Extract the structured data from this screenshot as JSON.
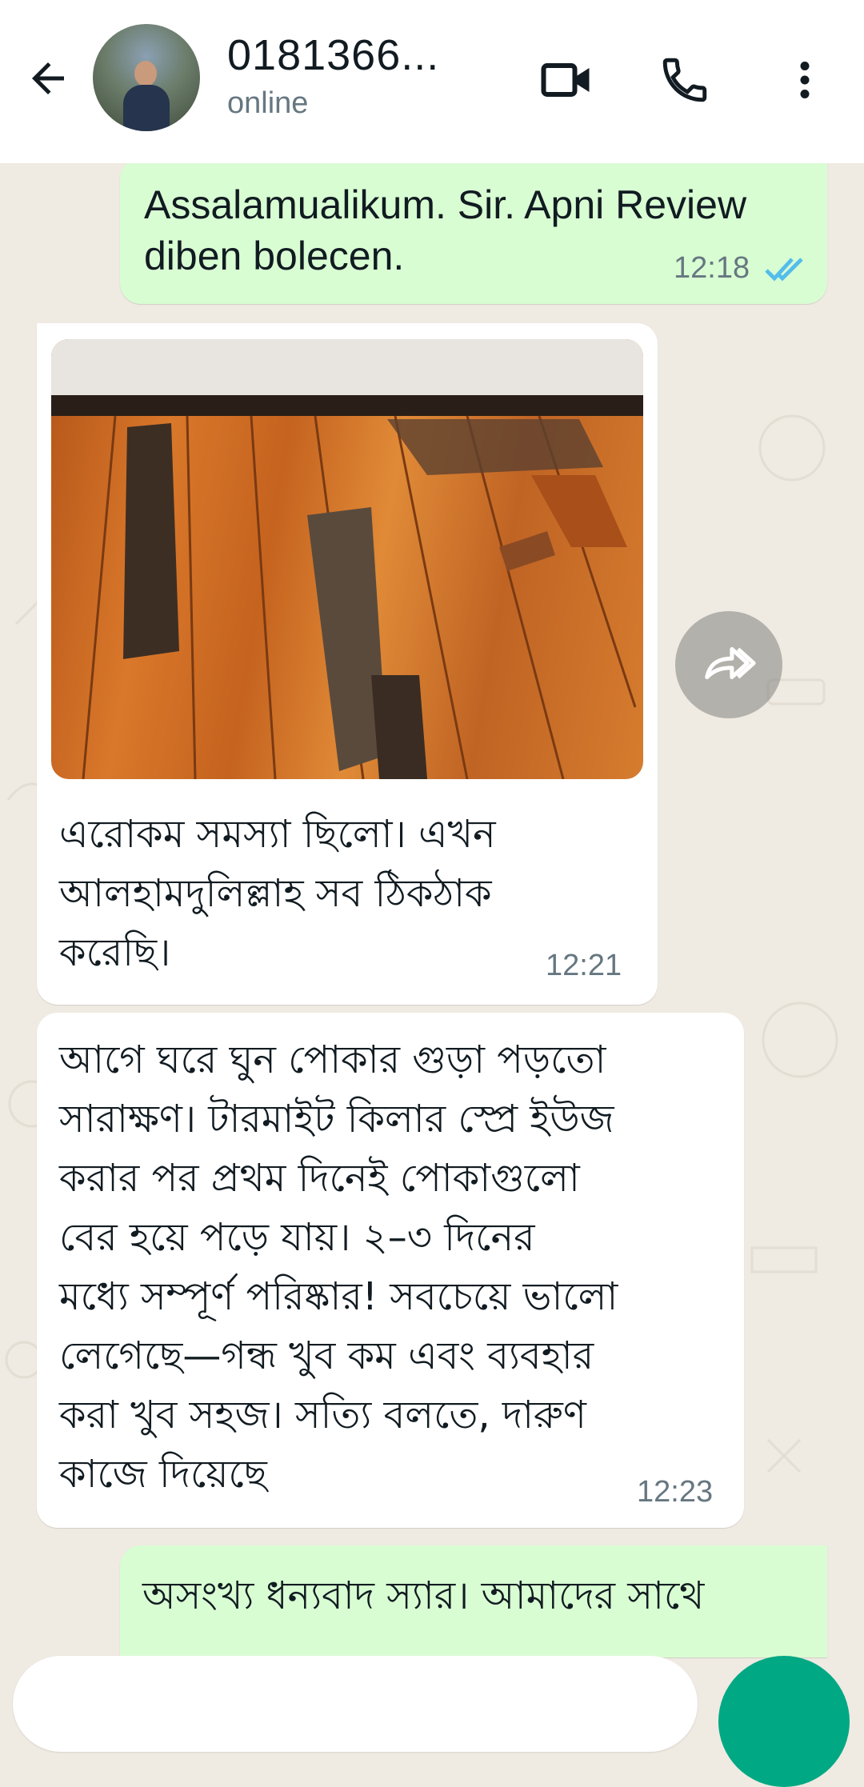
{
  "header": {
    "contact_name": "0181366...",
    "status": "online"
  },
  "messages": [
    {
      "direction": "outgoing",
      "text_line1": "Assalamualikum. Sir. Apni Review",
      "text_line2": "diben bolecen.",
      "time": "12:18",
      "read": true
    },
    {
      "direction": "incoming",
      "type": "image",
      "caption_lines": [
        "এরোকম সমস্যা ছিলো। এখন",
        "আলহামদুলিল্লাহ সব ঠিকঠাক",
        "করেছি।"
      ],
      "time": "12:21"
    },
    {
      "direction": "incoming",
      "lines": [
        "আগে ঘরে ঘুন পোকার গুড়া পড়তো",
        "সারাক্ষণ। টারমাইট কিলার স্প্রে ইউজ",
        "করার পর প্রথম দিনেই পোকাগুলো",
        "বের হয়ে পড়ে যায়। ২–৩ দিনের",
        "মধ্যে সম্পূর্ণ পরিষ্কার! সবচেয়ে ভালো",
        "লেগেছে—গন্ধ খুব কম এবং ব্যবহার",
        "করা খুব সহজ। সত্যি বলতে, দারুণ",
        "কাজে দিয়েছে"
      ],
      "time": "12:23"
    },
    {
      "direction": "outgoing",
      "text": "অসংখ্য ধন্যবাদ স্যার। আমাদের সাথে"
    }
  ],
  "icons": {
    "back": "arrow-left-icon",
    "video": "video-call-icon",
    "call": "phone-icon",
    "menu": "more-vert-icon",
    "forward": "forward-icon",
    "read": "double-check-icon"
  },
  "colors": {
    "outgoing_bubble": "#d9fdd3",
    "incoming_bubble": "#ffffff",
    "chat_background": "#efeae2",
    "read_ticks": "#53bdeb",
    "accent": "#00a884"
  }
}
